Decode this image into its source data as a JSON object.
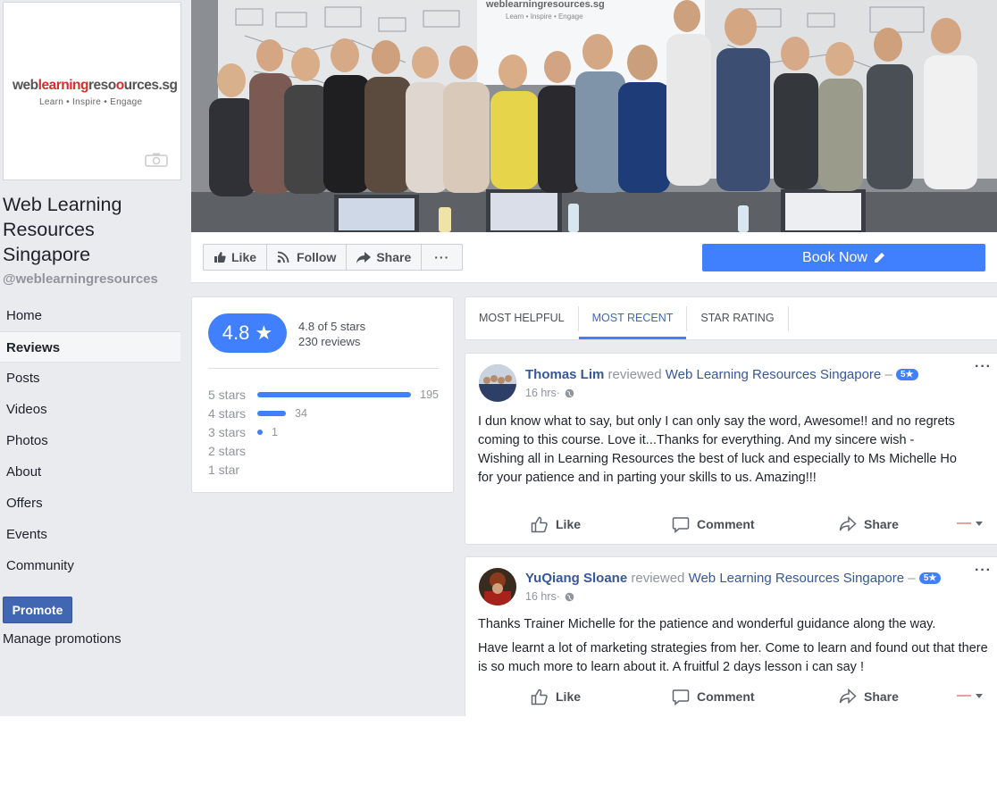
{
  "page": {
    "name": "Web Learning Resources Singapore",
    "handle": "@weblearningresources",
    "logo_text": {
      "part1": "web",
      "part2": "learning",
      "part3": "reso",
      "part4": "urces.sg"
    },
    "logo_tagline": "Learn  •  Inspire  •  Engage"
  },
  "sidebar": {
    "items": [
      {
        "label": "Home"
      },
      {
        "label": "Reviews"
      },
      {
        "label": "Posts"
      },
      {
        "label": "Videos"
      },
      {
        "label": "Photos"
      },
      {
        "label": "About"
      },
      {
        "label": "Offers"
      },
      {
        "label": "Events"
      },
      {
        "label": "Community"
      }
    ],
    "active": "Reviews",
    "promote_label": "Promote",
    "manage_label": "Manage promotions"
  },
  "cover": {
    "screen_brand": "weblearningresources.sg",
    "screen_tagline": "Learn  •  Inspire  •  Engage"
  },
  "toolbar": {
    "like_label": "Like",
    "follow_label": "Follow",
    "share_label": "Share",
    "more_label": "···",
    "book_label": "Book Now"
  },
  "rating": {
    "score": "4.8 ★",
    "summary": "4.8 of 5 stars",
    "count": "230 reviews",
    "distribution": [
      {
        "label": "5 stars",
        "count": "195",
        "fraction": 0.87
      },
      {
        "label": "4 stars",
        "count": "34",
        "fraction": 0.16
      },
      {
        "label": "3 stars",
        "count": "1",
        "fraction": 0.03
      },
      {
        "label": "2 stars",
        "count": "",
        "fraction": 0
      },
      {
        "label": "1 star",
        "count": "",
        "fraction": 0
      }
    ]
  },
  "tabs": [
    {
      "label": "Most Helpful"
    },
    {
      "label": "Most Recent"
    },
    {
      "label": "Star Rating"
    }
  ],
  "active_tab": "Most Recent",
  "reviews": [
    {
      "author": "Thomas Lim",
      "verb": "reviewed",
      "page": "Web Learning Resources Singapore",
      "dash": "–",
      "stars": "5★",
      "time": "16 hrs",
      "paragraphs": [
        "I dun know what to say, but only I can only say the word, Awesome!! and no regrets coming to this course. Love it...Thanks for everything. And my sincere wish - Wishing all in Learning Resources the best of luck and especially to Ms Michelle Ho for your patience and in parting your skills to us. Amazing!!!"
      ]
    },
    {
      "author": "YuQiang Sloane",
      "verb": "reviewed",
      "page": "Web Learning Resources Singapore",
      "dash": "–",
      "stars": "5★",
      "time": "16 hrs",
      "paragraphs": [
        "Thanks Trainer Michelle for the patience and wonderful guidance along the way.",
        "Have learnt a lot of marketing strategies from her. Come to learn and found out that there is so much more to learn about it. A fruitful 2 days lesson i can say !"
      ]
    }
  ],
  "post_actions": {
    "like": "Like",
    "comment": "Comment",
    "share": "Share"
  },
  "colors": {
    "brand_blue": "#4267b2",
    "accent_blue": "#4080ff",
    "bg": "#e9ebee"
  }
}
